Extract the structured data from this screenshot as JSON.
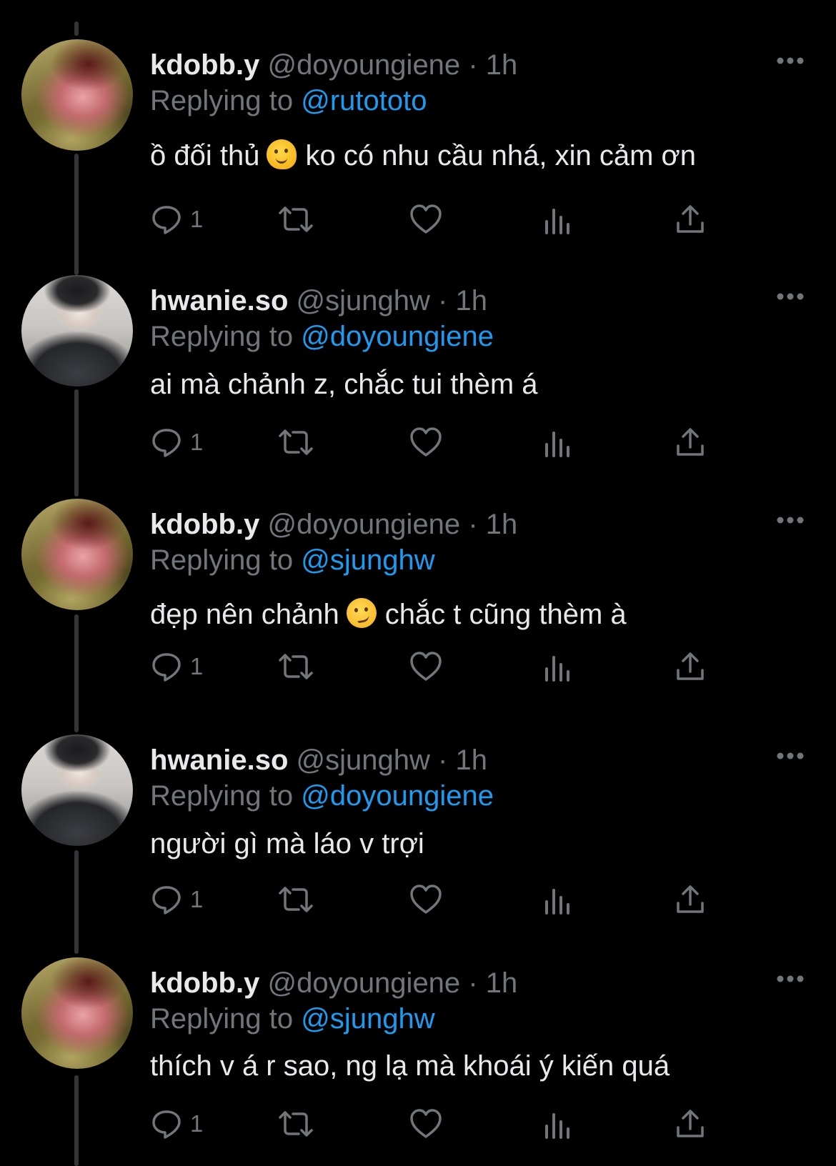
{
  "colors": {
    "background": "#000000",
    "text": "#e7e9ea",
    "secondary": "#71767b",
    "link": "#1d9bf0",
    "thread_line": "#333639"
  },
  "labels": {
    "replying_to": "Replying to",
    "separator": "·"
  },
  "tweets": [
    {
      "display_name": "kdobb.y",
      "handle": "@doyoungiene",
      "time": "1h",
      "reply_to": "@rutototo",
      "text_before": "ồ đối thủ",
      "emoji": "melting-face-emoji",
      "text_after": "ko có nhu cầu nhá, xin cảm ơn",
      "reply_count": "1"
    },
    {
      "display_name": "hwanie.so",
      "handle": "@sjunghw",
      "time": "1h",
      "reply_to": "@doyoungiene",
      "text_before": "ai mà chảnh z, chắc tui thèm á",
      "emoji": null,
      "text_after": "",
      "reply_count": "1"
    },
    {
      "display_name": "kdobb.y",
      "handle": "@doyoungiene",
      "time": "1h",
      "reply_to": "@sjunghw",
      "text_before": "đẹp nên chảnh",
      "emoji": "smirking-face-emoji",
      "text_after": "chắc t cũng thèm à",
      "reply_count": "1"
    },
    {
      "display_name": "hwanie.so",
      "handle": "@sjunghw",
      "time": "1h",
      "reply_to": "@doyoungiene",
      "text_before": "người gì mà láo v trợi",
      "emoji": null,
      "text_after": "",
      "reply_count": "1"
    },
    {
      "display_name": "kdobb.y",
      "handle": "@doyoungiene",
      "time": "1h",
      "reply_to": "@sjunghw",
      "text_before": "thích v á r sao, ng lạ mà khoái ý kiến quá",
      "emoji": null,
      "text_after": "",
      "reply_count": "1"
    }
  ]
}
